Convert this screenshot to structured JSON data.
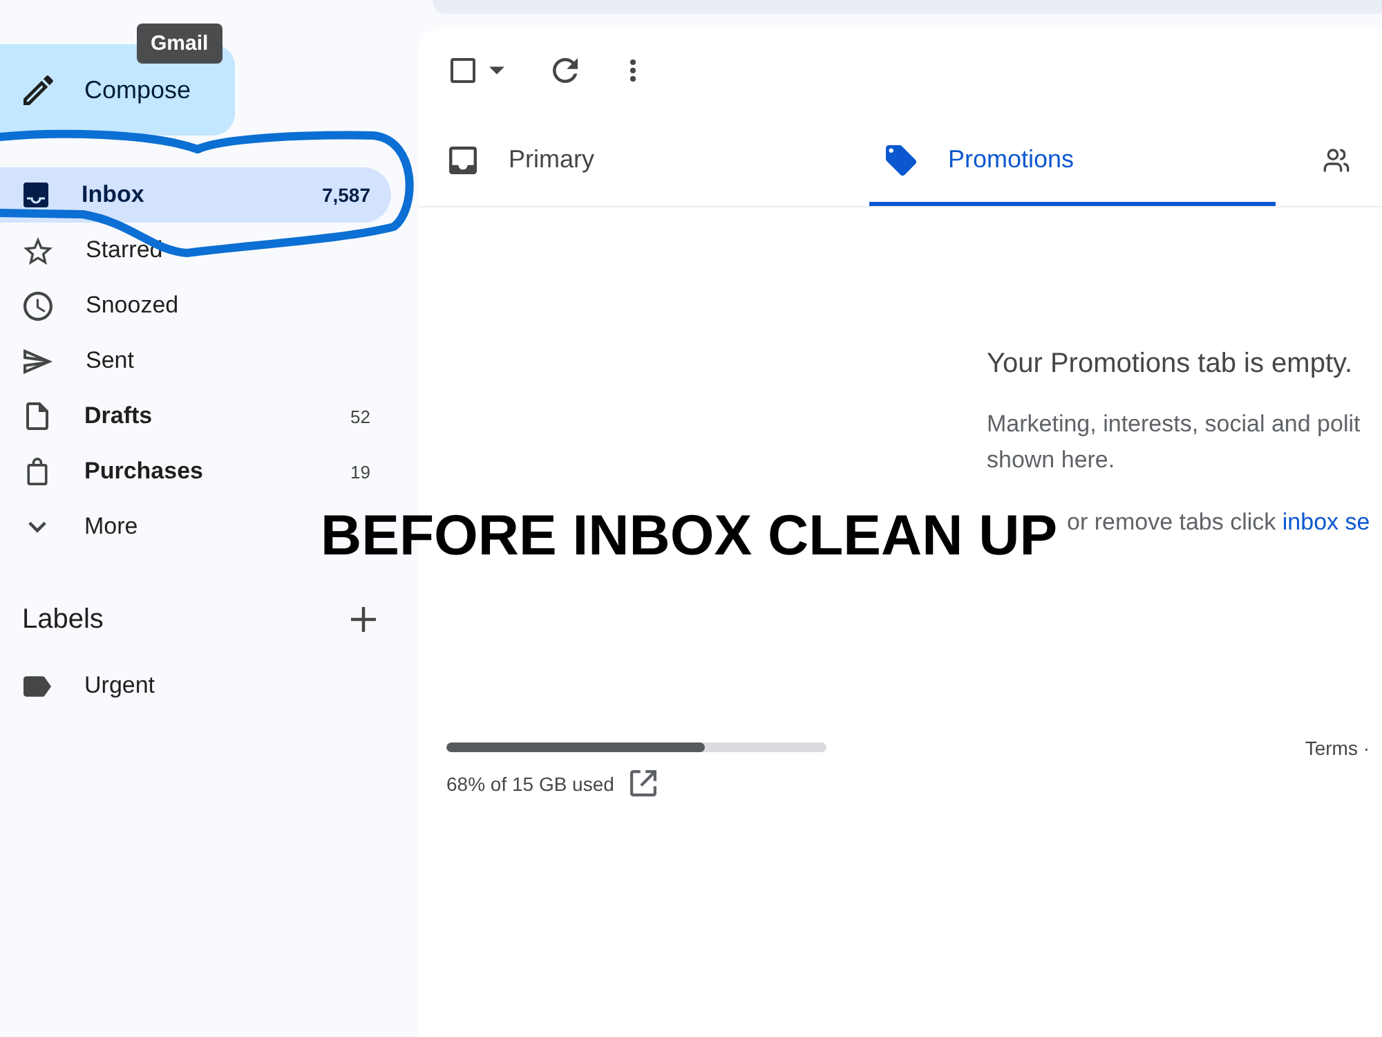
{
  "sidebar": {
    "compose": {
      "label": "Compose"
    },
    "tooltip": {
      "text": "Gmail"
    },
    "items": [
      {
        "label": "Inbox",
        "count": "7,587",
        "selected": true,
        "unread": true,
        "circled": true
      },
      {
        "label": "Starred",
        "selected": false,
        "unread": false,
        "circled": false
      },
      {
        "label": "Snoozed",
        "selected": false,
        "unread": false,
        "circled": false
      },
      {
        "label": "Sent",
        "selected": false,
        "unread": false,
        "circled": false
      },
      {
        "label": "Drafts",
        "count": "52",
        "selected": false,
        "unread": true,
        "circled": false
      },
      {
        "label": "Purchases",
        "count": "19",
        "selected": false,
        "unread": true,
        "circled": false
      },
      {
        "label": "More",
        "selected": false,
        "unread": false,
        "circled": false
      }
    ],
    "labels_heading": "Labels",
    "labels": [
      {
        "name": "Urgent"
      }
    ]
  },
  "toolbar": {
    "select_all": {
      "checked": false
    }
  },
  "tabs": [
    {
      "label": "Primary",
      "selected": false
    },
    {
      "label": "Promotions",
      "selected": true
    },
    {
      "selected": false
    }
  ],
  "empty_state": {
    "title": "Your Promotions tab is empty.",
    "description_lines": [
      "Marketing, interests, social and polit",
      "shown here."
    ],
    "hint": "or remove tabs click ",
    "hint_link": "inbox se"
  },
  "storage": {
    "level": 0.68,
    "text": "68% of 15 GB used"
  },
  "footer": {
    "links": "Terms ·"
  },
  "overlay_caption": "BEFORE INBOX CLEAN UP"
}
